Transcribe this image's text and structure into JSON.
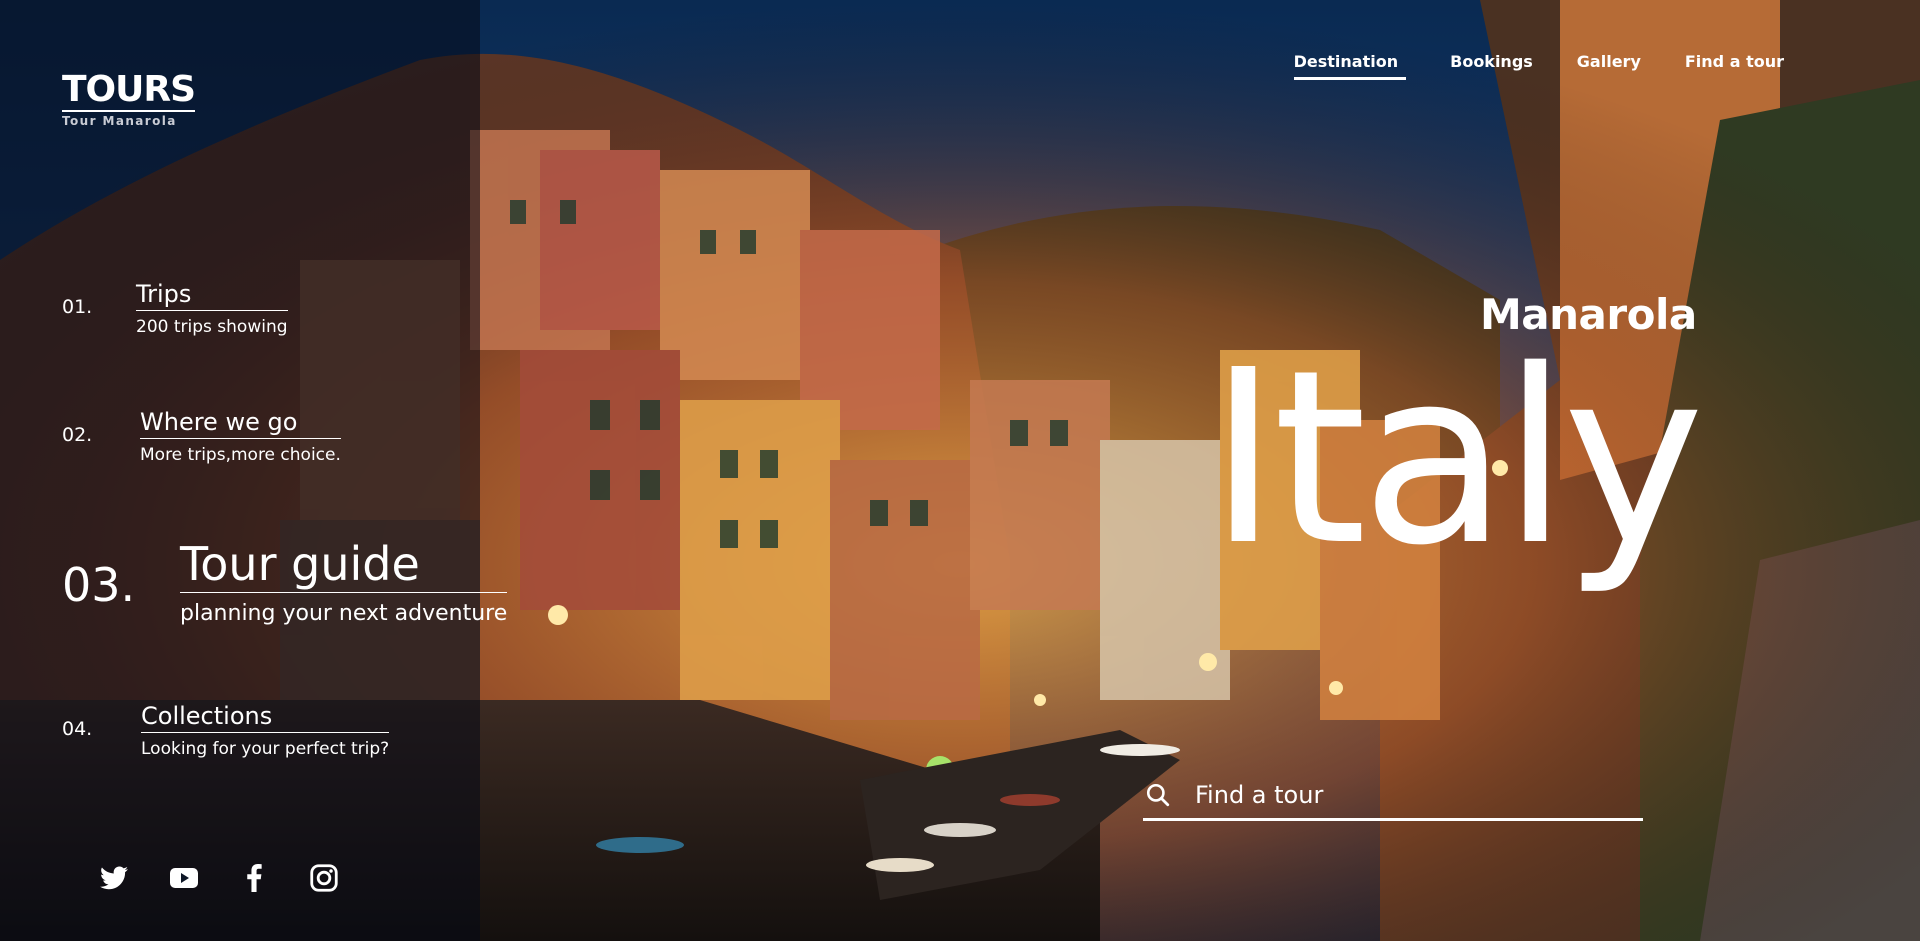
{
  "brand": {
    "title": "TOURS",
    "subtitle": "Tour Manarola"
  },
  "nav": {
    "items": [
      {
        "label": "Destination",
        "active": true
      },
      {
        "label": "Bookings",
        "active": false
      },
      {
        "label": "Gallery",
        "active": false
      },
      {
        "label": "Find a tour",
        "active": false
      }
    ]
  },
  "menu": {
    "items": [
      {
        "number": "01.",
        "label": "Trips",
        "sub": "200 trips showing"
      },
      {
        "number": "02.",
        "label": "Where we go",
        "sub": "More trips,more choice."
      },
      {
        "number": "03.",
        "label": "Tour guide",
        "sub": "planning your next adventure"
      },
      {
        "number": "04.",
        "label": "Collections",
        "sub": "Looking for your perfect trip?"
      }
    ]
  },
  "hero": {
    "subtitle": "Manarola",
    "title": "Italy"
  },
  "search": {
    "placeholder": "Find a tour",
    "value": ""
  },
  "socials": {
    "icons": [
      "twitter-icon",
      "youtube-icon",
      "facebook-icon",
      "instagram-icon"
    ]
  },
  "colors": {
    "text": "#ffffff",
    "panel": "#050a16",
    "sky": "#0e2a50"
  }
}
